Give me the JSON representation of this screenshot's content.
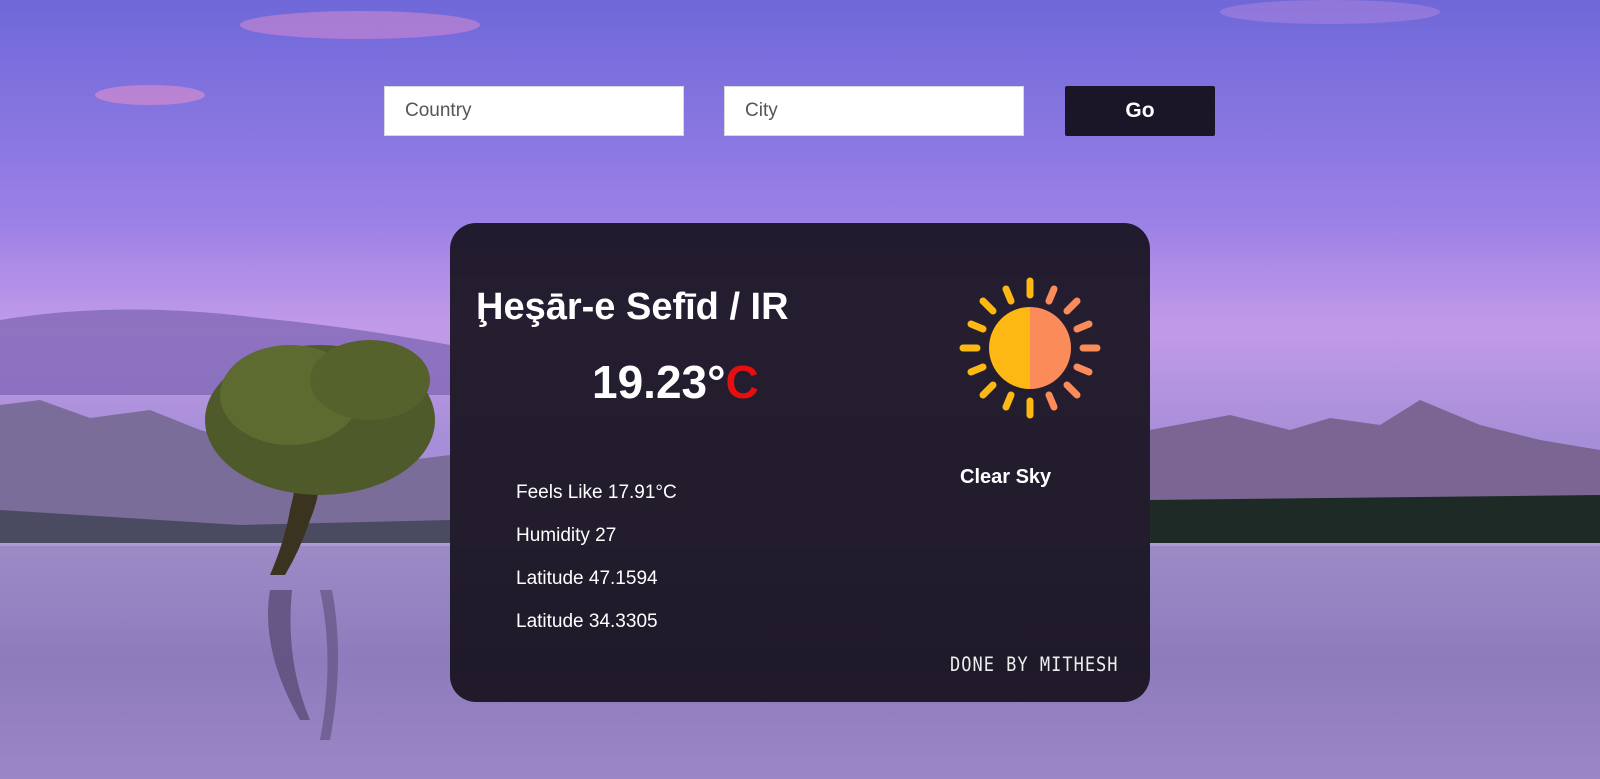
{
  "search": {
    "country_placeholder": "Country",
    "city_placeholder": "City",
    "go_label": "Go"
  },
  "weather": {
    "place": "Ḩeşār-e Sefīd / IR",
    "temp_value": "19.23°",
    "temp_unit": "C",
    "icon": "sun-icon",
    "description": "Clear Sky",
    "feels_like": "Feels Like 17.91°C",
    "humidity": "Humidity 27",
    "latitude_1": "Latitude 47.1594",
    "latitude_2": "Latitude 34.3305",
    "credit": "DONE BY MITHESH"
  },
  "colors": {
    "card_bg": "#100c16",
    "button_bg": "#1a1628",
    "unit_red": "#e60f0f",
    "sun_yellow": "#fdb813",
    "sun_orange": "#fb8c5a"
  }
}
